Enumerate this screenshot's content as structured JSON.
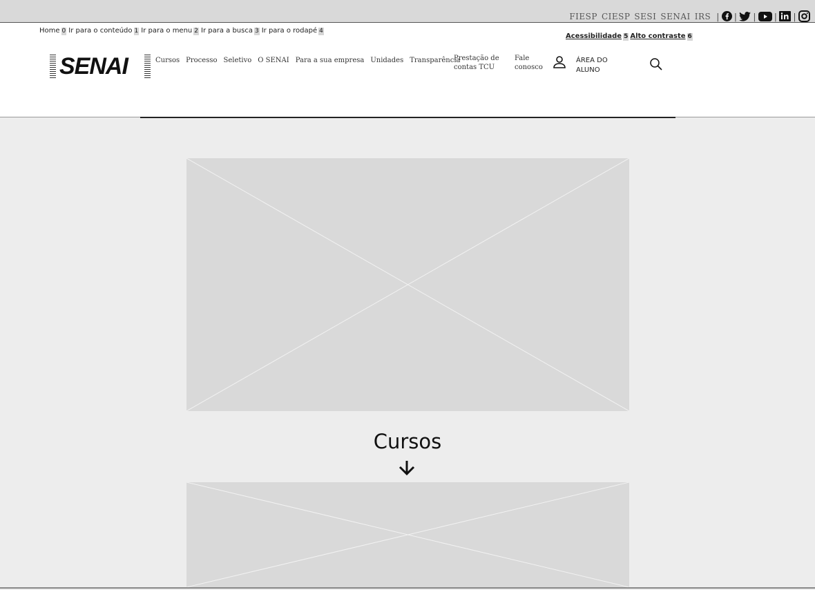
{
  "federation": {
    "orgs": [
      "FIESP",
      "CIESP",
      "SESI",
      "SENAI",
      "IRS"
    ]
  },
  "social": [
    "facebook-icon",
    "twitter-icon",
    "youtube-icon",
    "linkedin-icon",
    "instagram-icon"
  ],
  "skiplinks": [
    {
      "label": "Home",
      "key": "0"
    },
    {
      "label": "Ir para o conteúdo",
      "key": "1"
    },
    {
      "label": "Ir para o menu",
      "key": "2"
    },
    {
      "label": "Ir para a busca",
      "key": "3"
    },
    {
      "label": "Ir para o rodapé",
      "key": "4"
    }
  ],
  "accessibility": {
    "label": "Acessibilidade",
    "key": "5",
    "contrast_label": "Alto contraste",
    "contrast_key": "6"
  },
  "logo": {
    "text": "SENAI"
  },
  "nav": {
    "items": [
      "Cursos",
      "Processo",
      "Seletivo",
      "O SENAI",
      "Para a sua empresa",
      "Unidades",
      "Transparência"
    ],
    "prestacao_line1": "Prestação de",
    "prestacao_line2": "contas TCU",
    "fale_line1": "Fale",
    "fale_line2": "conosco"
  },
  "student_area": {
    "line1": "ÁREA DO",
    "line2": "ALUNO"
  },
  "main": {
    "section_title": "Cursos"
  },
  "colors": {
    "topbar": "#d9d9d9",
    "page_bg": "#ededed",
    "placeholder": "#d9d9d9"
  }
}
